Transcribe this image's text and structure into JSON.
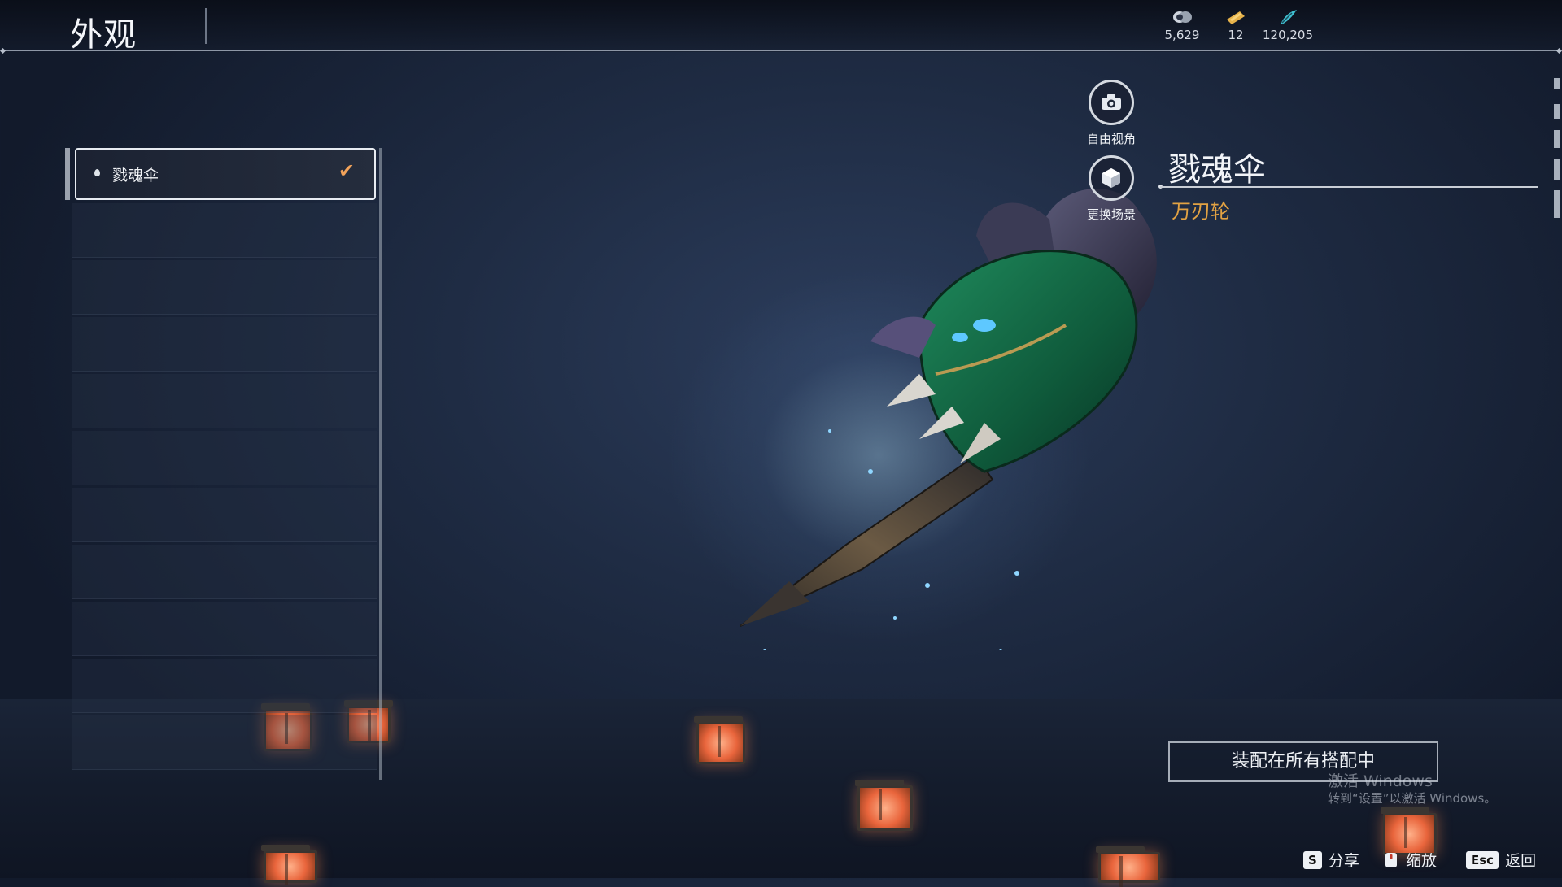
{
  "header": {
    "title": "外观",
    "currencies": [
      {
        "icon": "coin-stack-icon",
        "value": "5,629"
      },
      {
        "icon": "ticket-icon",
        "value": "12"
      },
      {
        "icon": "feather-icon",
        "value": "120,205"
      }
    ]
  },
  "list": {
    "items": [
      {
        "label": "戮魂伞",
        "selected": true,
        "equipped": true
      }
    ]
  },
  "side_buttons": {
    "free_view": "自由视角",
    "change_scene": "更换场景"
  },
  "weapon": {
    "name": "戮魂伞",
    "type": "万刃轮"
  },
  "equip_button": "装配在所有搭配中",
  "watermark": {
    "line1": "激活 Windows",
    "line2": "转到“设置”以激活 Windows。"
  },
  "footer_hints": [
    {
      "key": "S",
      "label": "分享"
    },
    {
      "key": "",
      "label": "缩放"
    },
    {
      "key": "Esc",
      "label": "返回"
    }
  ],
  "colors": {
    "accent_orange": "#e2a243",
    "check": "#f2a35a",
    "background": "#1f2c44"
  }
}
